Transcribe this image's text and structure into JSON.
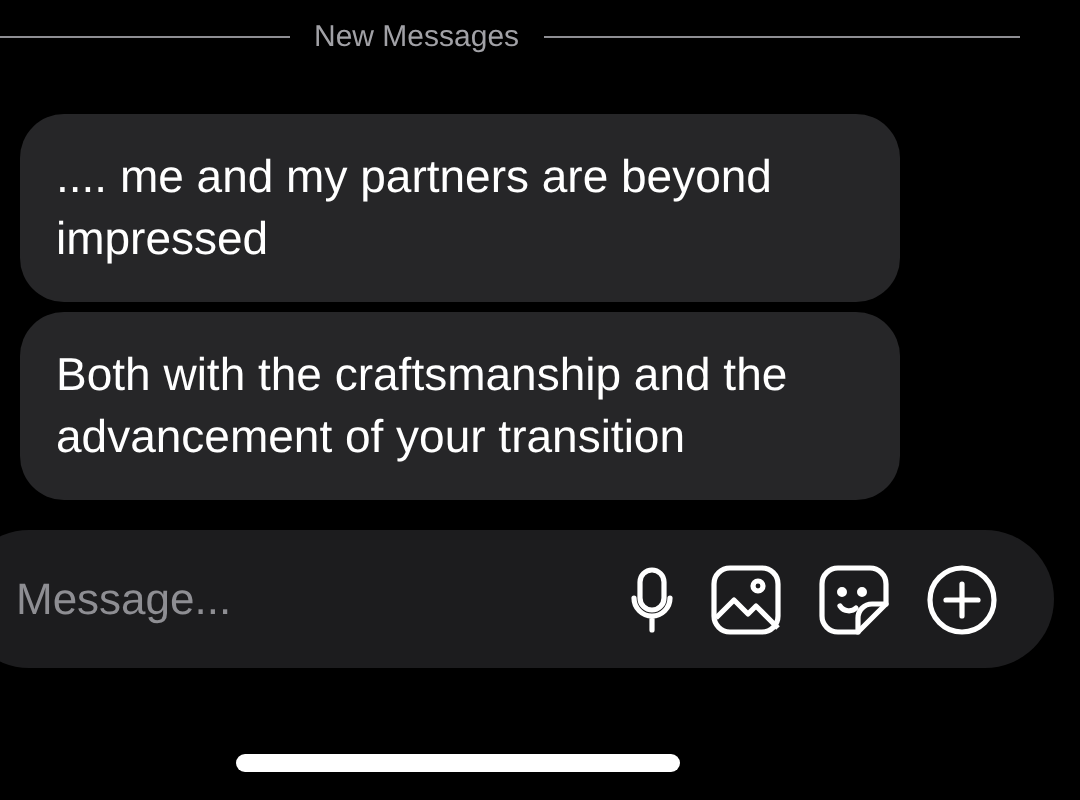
{
  "divider": {
    "label": "New Messages"
  },
  "messages": [
    {
      "text": ".... me and my partners are beyond impressed"
    },
    {
      "text": "Both with the craftsmanship and the advancement of your transition"
    }
  ],
  "composer": {
    "placeholder": "Message..."
  }
}
